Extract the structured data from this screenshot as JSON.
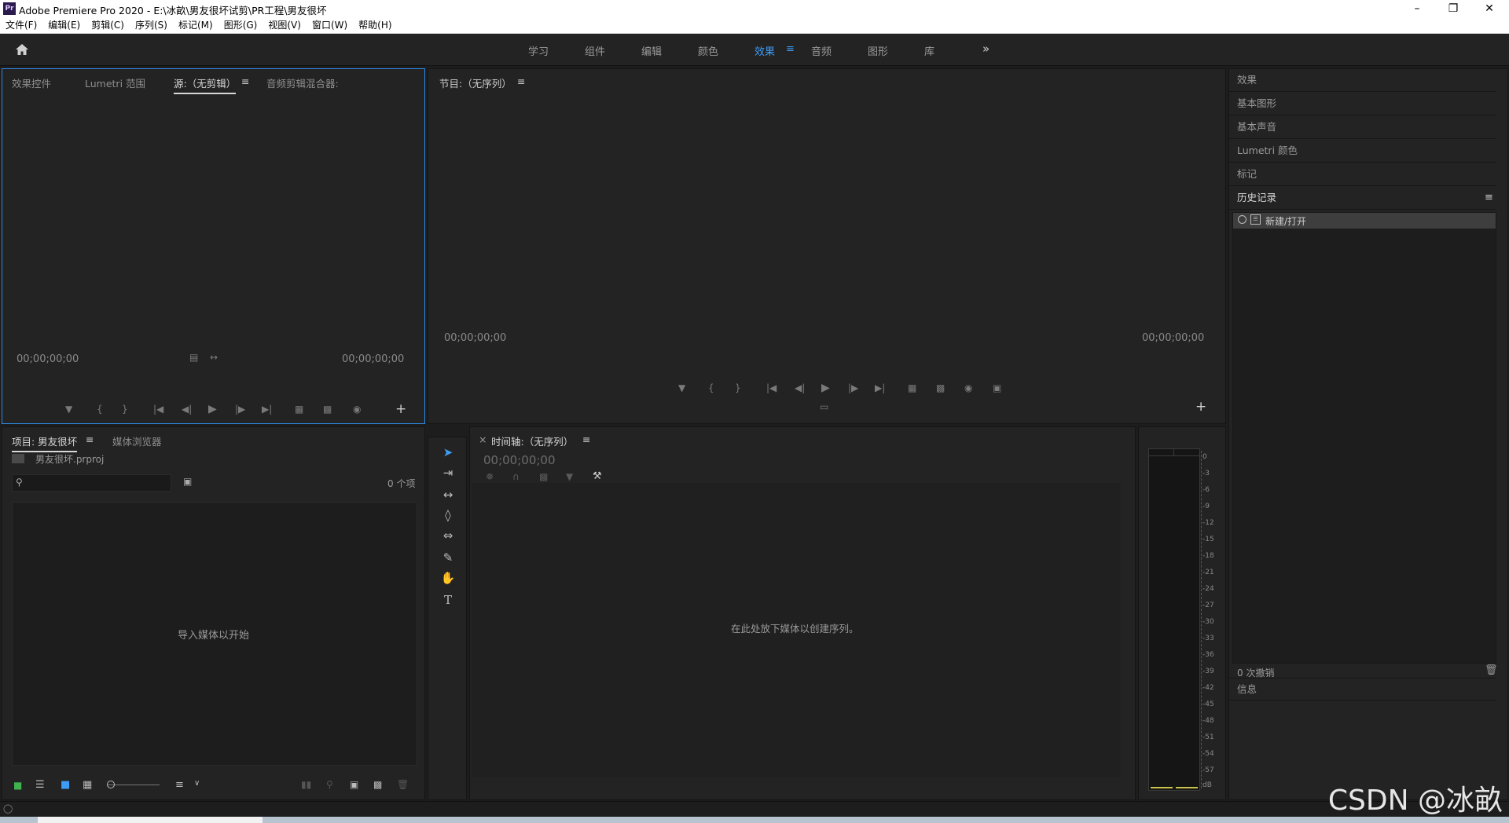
{
  "window": {
    "title": "Adobe Premiere Pro 2020 - E:\\冰畝\\男友很坏试剪\\PR工程\\男友很坏",
    "app_badge": "Pr"
  },
  "menu": [
    "文件(F)",
    "编辑(E)",
    "剪辑(C)",
    "序列(S)",
    "标记(M)",
    "图形(G)",
    "视图(V)",
    "窗口(W)",
    "帮助(H)"
  ],
  "workspaces": {
    "items": [
      "学习",
      "组件",
      "编辑",
      "颜色",
      "效果",
      "音频",
      "图形",
      "库"
    ],
    "active": "效果",
    "more": "»"
  },
  "source_panel": {
    "tabs": [
      "效果控件",
      "Lumetri 范围",
      "源:（无剪辑）",
      "音频剪辑混合器:"
    ],
    "active_tab": "源:（无剪辑）",
    "timecode_left": "00;00;00;00",
    "timecode_right": "00;00;00;00"
  },
  "program_panel": {
    "title": "节目:（无序列）",
    "timecode_left": "00;00;00;00",
    "timecode_right": "00;00;00;00"
  },
  "right_panels": {
    "items": [
      "效果",
      "基本图形",
      "基本声音",
      "Lumetri 颜色",
      "标记"
    ],
    "history_title": "历史记录",
    "history_entries": [
      "新建/打开"
    ],
    "undo_count": "0 次撤销",
    "info": "信息"
  },
  "project_panel": {
    "tabs": [
      "项目: 男友很坏",
      "媒体浏览器"
    ],
    "file_name": "男友很坏.prproj",
    "item_count": "0 个项",
    "search_placeholder": "",
    "empty_message": "导入媒体以开始"
  },
  "timeline_panel": {
    "title": "时间轴:（无序列）",
    "timecode": "00;00;00;00",
    "empty_message": "在此处放下媒体以创建序列。"
  },
  "audio_meter": {
    "ticks": [
      "0",
      "-3",
      "-6",
      "-9",
      "-12",
      "-15",
      "-18",
      "-21",
      "-24",
      "-27",
      "-30",
      "-33",
      "-36",
      "-39",
      "-42",
      "-45",
      "-48",
      "-51",
      "-54",
      "-57",
      "dB"
    ]
  },
  "watermark": "CSDN @冰畝",
  "colors": {
    "accent": "#2d8ceb",
    "panel_bg": "#232323",
    "frame_bg": "#1d1d1d"
  }
}
